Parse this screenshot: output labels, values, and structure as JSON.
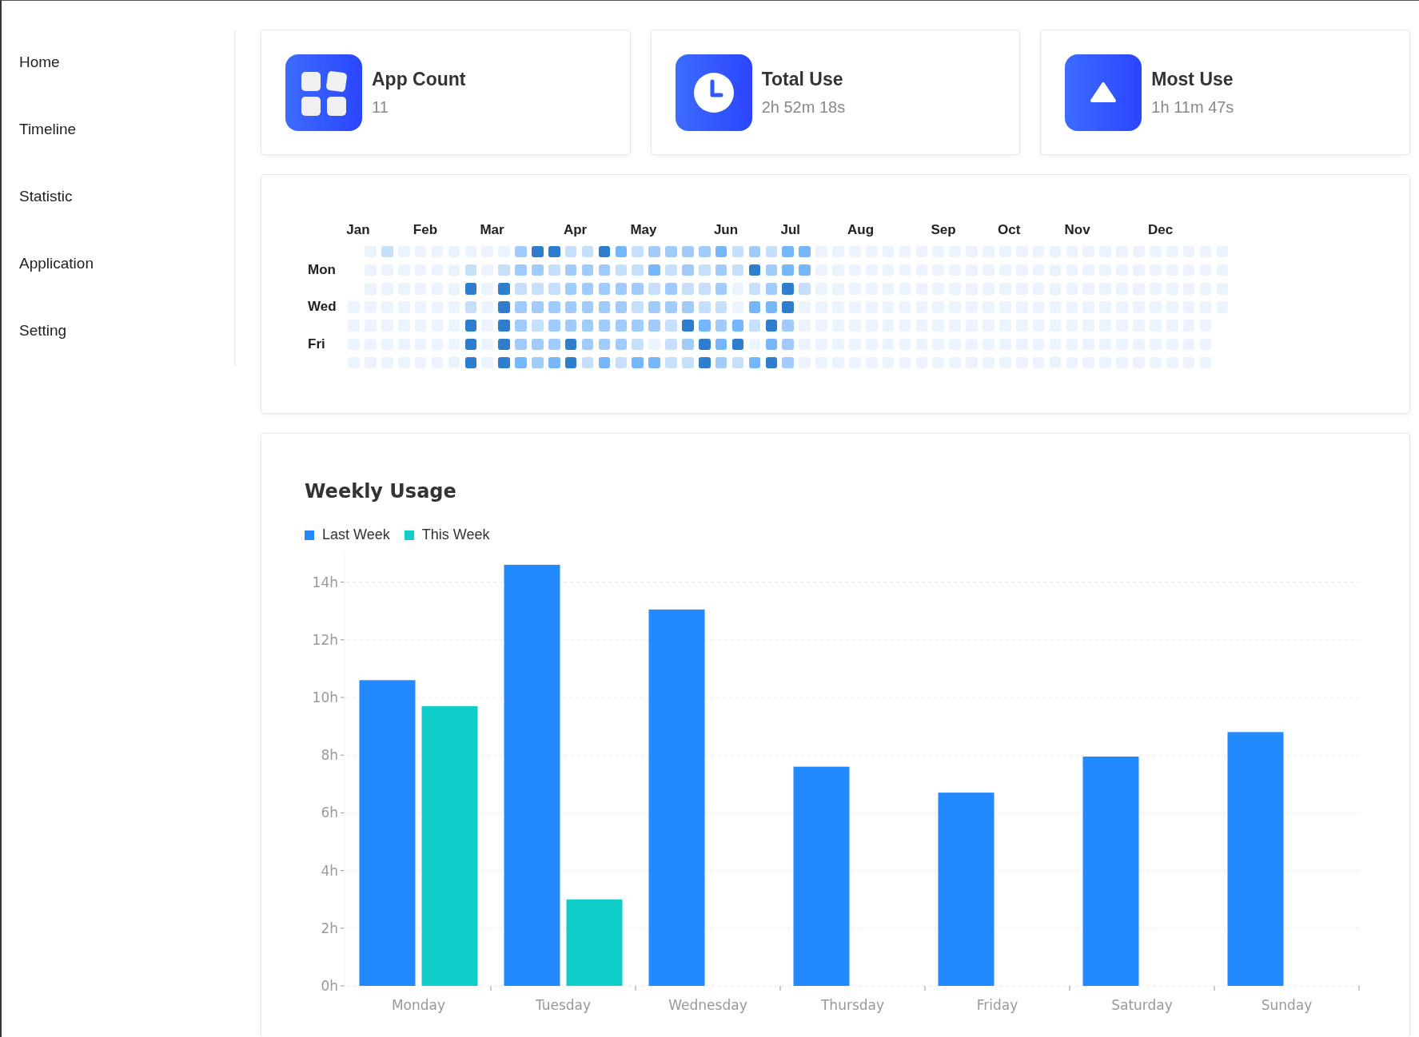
{
  "sidebar": {
    "items": [
      {
        "label": "Home",
        "selected": false
      },
      {
        "label": "Timeline",
        "selected": false
      },
      {
        "label": "Statistic",
        "selected": false
      },
      {
        "label": "Application",
        "selected": false
      },
      {
        "label": "Setting",
        "selected": false
      }
    ]
  },
  "summary_cards": [
    {
      "kind": "apps",
      "title": "App Count",
      "value": "11"
    },
    {
      "kind": "clock",
      "title": "Total Use",
      "value": "2h 52m 18s"
    },
    {
      "kind": "peak",
      "title": "Most Use",
      "value": "1h 11m 47s"
    }
  ],
  "heatmap": {
    "weekday_labels": [
      "Mon",
      "Wed",
      "Fri"
    ],
    "weeks": [
      {
        "month": "Jan",
        "days": [
          {
            "color": "#ebf3fe"
          },
          {
            "color": "#ebf3fe"
          },
          {
            "color": "#ebf3fe"
          },
          {
            "color": "#ebf3fe"
          }
        ]
      },
      {
        "days": [
          {
            "color": "#ebf3fe"
          },
          {
            "color": "#ebf3fe"
          },
          {
            "color": "#ebf3fe"
          },
          {
            "color": "#ebf3fe"
          },
          {
            "color": "#ebf3fe"
          },
          {
            "color": "#ebf3fe"
          },
          {
            "color": "#ebf3fe"
          }
        ]
      },
      {
        "days": [
          {
            "color": "#c6e0fc"
          },
          {
            "color": "#ebf3fe"
          },
          {
            "color": "#ebf3fe"
          },
          {
            "color": "#ebf3fe"
          },
          {
            "color": "#ebf3fe"
          },
          {
            "color": "#ebf3fe"
          },
          {
            "color": "#ebf3fe"
          }
        ]
      },
      {
        "days": [
          {
            "color": "#ebf3fe"
          },
          {
            "color": "#ebf3fe"
          },
          {
            "color": "#ebf3fe"
          },
          {
            "color": "#ebf3fe"
          },
          {
            "color": "#ebf3fe"
          },
          {
            "color": "#ebf3fe"
          },
          {
            "color": "#ebf3fe"
          }
        ]
      },
      {
        "month": "Feb",
        "days": [
          {
            "color": "#ebf3fe"
          },
          {
            "color": "#ebf3fe"
          },
          {
            "color": "#ebf3fe"
          },
          {
            "color": "#ebf3fe"
          },
          {
            "color": "#ebf3fe"
          },
          {
            "color": "#ebf3fe"
          },
          {
            "color": "#ebf3fe"
          }
        ]
      },
      {
        "days": [
          {
            "color": "#ebf3fe"
          },
          {
            "color": "#ebf3fe"
          },
          {
            "color": "#ebf3fe"
          },
          {
            "color": "#ebf3fe"
          },
          {
            "color": "#ebf3fe"
          },
          {
            "color": "#ebf3fe"
          },
          {
            "color": "#ebf3fe"
          }
        ]
      },
      {
        "days": [
          {
            "color": "#ebf3fe"
          },
          {
            "color": "#ebf3fe"
          },
          {
            "color": "#ebf3fe"
          },
          {
            "color": "#ebf3fe"
          },
          {
            "color": "#ebf3fe"
          },
          {
            "color": "#ebf3fe"
          },
          {
            "color": "#ebf3fe"
          }
        ]
      },
      {
        "days": [
          {
            "color": "#ebf3fe"
          },
          {
            "color": "#c6e0fc"
          },
          {
            "color": "#2f7dcd"
          },
          {
            "color": "#c6e0fc"
          },
          {
            "color": "#2f7dcd"
          },
          {
            "color": "#2f7dcd"
          },
          {
            "color": "#2f7dcd"
          }
        ]
      },
      {
        "month": "Mar",
        "days": [
          {
            "color": "#ebf3fe"
          },
          {
            "color": "#ebf3fe"
          },
          {
            "color": "#ebf3fe"
          },
          {
            "color": "#ebf3fe"
          },
          {
            "color": "#ebf3fe"
          },
          {
            "color": "#ebf3fe"
          },
          {
            "color": "#ebf3fe"
          }
        ]
      },
      {
        "days": [
          {
            "color": "#ebf3fe"
          },
          {
            "color": "#c6e0fc"
          },
          {
            "color": "#2f7dcd"
          },
          {
            "color": "#2f7dcd"
          },
          {
            "color": "#2f7dcd"
          },
          {
            "color": "#2f7dcd"
          },
          {
            "color": "#2f7dcd"
          }
        ]
      },
      {
        "days": [
          {
            "color": "#a0cbfb"
          },
          {
            "color": "#a0cbfb"
          },
          {
            "color": "#c6e0fc"
          },
          {
            "color": "#a0cbfb"
          },
          {
            "color": "#a0cbfb"
          },
          {
            "color": "#a0cbfb"
          },
          {
            "color": "#76b6fa"
          }
        ]
      },
      {
        "days": [
          {
            "color": "#2f7dcd"
          },
          {
            "color": "#a0cbfb"
          },
          {
            "color": "#c6e0fc"
          },
          {
            "color": "#a0cbfb"
          },
          {
            "color": "#c6e0fc"
          },
          {
            "color": "#a0cbfb"
          },
          {
            "color": "#a0cbfb"
          }
        ]
      },
      {
        "days": [
          {
            "color": "#2f7dcd"
          },
          {
            "color": "#c6e0fc"
          },
          {
            "color": "#c6e0fc"
          },
          {
            "color": "#a0cbfb"
          },
          {
            "color": "#a0cbfb"
          },
          {
            "color": "#a0cbfb"
          },
          {
            "color": "#76b6fa"
          }
        ]
      },
      {
        "month": "Apr",
        "days": [
          {
            "color": "#c6e0fc"
          },
          {
            "color": "#a0cbfb"
          },
          {
            "color": "#a0cbfb"
          },
          {
            "color": "#a0cbfb"
          },
          {
            "color": "#a0cbfb"
          },
          {
            "color": "#2f7dcd"
          },
          {
            "color": "#2f7dcd"
          }
        ]
      },
      {
        "days": [
          {
            "color": "#c6e0fc"
          },
          {
            "color": "#a0cbfb"
          },
          {
            "color": "#a0cbfb"
          },
          {
            "color": "#a0cbfb"
          },
          {
            "color": "#a0cbfb"
          },
          {
            "color": "#a0cbfb"
          },
          {
            "color": "#c6e0fc"
          }
        ]
      },
      {
        "days": [
          {
            "color": "#2f7dcd"
          },
          {
            "color": "#a0cbfb"
          },
          {
            "color": "#a0cbfb"
          },
          {
            "color": "#a0cbfb"
          },
          {
            "color": "#a0cbfb"
          },
          {
            "color": "#a0cbfb"
          },
          {
            "color": "#76b6fa"
          }
        ]
      },
      {
        "days": [
          {
            "color": "#76b6fa"
          },
          {
            "color": "#c6e0fc"
          },
          {
            "color": "#a0cbfb"
          },
          {
            "color": "#a0cbfb"
          },
          {
            "color": "#a0cbfb"
          },
          {
            "color": "#a0cbfb"
          },
          {
            "color": "#c6e0fc"
          }
        ]
      },
      {
        "month": "May",
        "days": [
          {
            "color": "#c6e0fc"
          },
          {
            "color": "#c6e0fc"
          },
          {
            "color": "#a0cbfb"
          },
          {
            "color": "#c6e0fc"
          },
          {
            "color": "#a0cbfb"
          },
          {
            "color": "#c6e0fc"
          },
          {
            "color": "#76b6fa"
          }
        ]
      },
      {
        "days": [
          {
            "color": "#a0cbfb"
          },
          {
            "color": "#76b6fa"
          },
          {
            "color": "#c6e0fc"
          },
          {
            "color": "#a0cbfb"
          },
          {
            "color": "#a0cbfb"
          },
          {
            "color": "#ebf3fe"
          },
          {
            "color": "#76b6fa"
          }
        ]
      },
      {
        "days": [
          {
            "color": "#a0cbfb"
          },
          {
            "color": "#c6e0fc"
          },
          {
            "color": "#a0cbfb"
          },
          {
            "color": "#a0cbfb"
          },
          {
            "color": "#c6e0fc"
          },
          {
            "color": "#c6e0fc"
          },
          {
            "color": "#c6e0fc"
          }
        ]
      },
      {
        "days": [
          {
            "color": "#a0cbfb"
          },
          {
            "color": "#a0cbfb"
          },
          {
            "color": "#c6e0fc"
          },
          {
            "color": "#a0cbfb"
          },
          {
            "color": "#2f7dcd"
          },
          {
            "color": "#a0cbfb"
          },
          {
            "color": "#c6e0fc"
          }
        ]
      },
      {
        "days": [
          {
            "color": "#a0cbfb"
          },
          {
            "color": "#c6e0fc"
          },
          {
            "color": "#c6e0fc"
          },
          {
            "color": "#c6e0fc"
          },
          {
            "color": "#76b6fa"
          },
          {
            "color": "#2f7dcd"
          },
          {
            "color": "#2f7dcd"
          }
        ]
      },
      {
        "month": "Jun",
        "days": [
          {
            "color": "#76b6fa"
          },
          {
            "color": "#a0cbfb"
          },
          {
            "color": "#a0cbfb"
          },
          {
            "color": "#c6e0fc"
          },
          {
            "color": "#a0cbfb"
          },
          {
            "color": "#76b6fa"
          },
          {
            "color": "#a0cbfb"
          }
        ]
      },
      {
        "days": [
          {
            "color": "#c6e0fc"
          },
          {
            "color": "#c6e0fc"
          },
          {
            "color": "#ebf3fe"
          },
          {
            "color": "#ebf3fe"
          },
          {
            "color": "#76b6fa"
          },
          {
            "color": "#2f7dcd"
          },
          {
            "color": "#c6e0fc"
          }
        ]
      },
      {
        "days": [
          {
            "color": "#a0cbfb"
          },
          {
            "color": "#2f7dcd"
          },
          {
            "color": "#c6e0fc"
          },
          {
            "color": "#76b6fa"
          },
          {
            "color": "#c6e0fc"
          },
          {
            "color": "#ebf3fe"
          },
          {
            "color": "#76b6fa"
          }
        ]
      },
      {
        "days": [
          {
            "color": "#c6e0fc"
          },
          {
            "color": "#a0cbfb"
          },
          {
            "color": "#a0cbfb"
          },
          {
            "color": "#76b6fa"
          },
          {
            "color": "#2f7dcd"
          },
          {
            "color": "#76b6fa"
          },
          {
            "color": "#2f7dcd"
          }
        ]
      },
      {
        "month": "Jul",
        "days": [
          {
            "color": "#76b6fa"
          },
          {
            "color": "#76b6fa"
          },
          {
            "color": "#2f7dcd"
          },
          {
            "color": "#2f7dcd"
          },
          {
            "color": "#a0cbfb"
          },
          {
            "color": "#a0cbfb"
          },
          {
            "color": "#a0cbfb"
          }
        ]
      },
      {
        "days": [
          {
            "color": "#76b6fa"
          },
          {
            "color": "#76b6fa"
          },
          {
            "color": "#c6e0fc"
          },
          {
            "color": "#ebf3fe"
          },
          {
            "color": "#ebf3fe"
          },
          {
            "color": "#ebf3fe"
          },
          {
            "color": "#ebf3fe"
          }
        ]
      },
      {
        "days": [
          {
            "color": "#ebf3fe"
          },
          {
            "color": "#ebf3fe"
          },
          {
            "color": "#ebf3fe"
          },
          {
            "color": "#ebf3fe"
          },
          {
            "color": "#ebf3fe"
          },
          {
            "color": "#ebf3fe"
          },
          {
            "color": "#ebf3fe"
          }
        ]
      },
      {
        "days": [
          {
            "color": "#ebf3fe"
          },
          {
            "color": "#ebf3fe"
          },
          {
            "color": "#ebf3fe"
          },
          {
            "color": "#ebf3fe"
          },
          {
            "color": "#ebf3fe"
          },
          {
            "color": "#ebf3fe"
          },
          {
            "color": "#ebf3fe"
          }
        ]
      },
      {
        "month": "Aug",
        "days": [
          {
            "color": "#ebf3fe"
          },
          {
            "color": "#ebf3fe"
          },
          {
            "color": "#ebf3fe"
          },
          {
            "color": "#ebf3fe"
          },
          {
            "color": "#ebf3fe"
          },
          {
            "color": "#ebf3fe"
          },
          {
            "color": "#ebf3fe"
          }
        ]
      },
      {
        "days": [
          {
            "color": "#ebf3fe"
          },
          {
            "color": "#ebf3fe"
          },
          {
            "color": "#ebf3fe"
          },
          {
            "color": "#ebf3fe"
          },
          {
            "color": "#ebf3fe"
          },
          {
            "color": "#ebf3fe"
          },
          {
            "color": "#ebf3fe"
          }
        ]
      },
      {
        "days": [
          {
            "color": "#ebf3fe"
          },
          {
            "color": "#ebf3fe"
          },
          {
            "color": "#ebf3fe"
          },
          {
            "color": "#ebf3fe"
          },
          {
            "color": "#ebf3fe"
          },
          {
            "color": "#ebf3fe"
          },
          {
            "color": "#ebf3fe"
          }
        ]
      },
      {
        "days": [
          {
            "color": "#ebf3fe"
          },
          {
            "color": "#ebf3fe"
          },
          {
            "color": "#ebf3fe"
          },
          {
            "color": "#ebf3fe"
          },
          {
            "color": "#ebf3fe"
          },
          {
            "color": "#ebf3fe"
          },
          {
            "color": "#ebf3fe"
          }
        ]
      },
      {
        "days": [
          {
            "color": "#ebf3fe"
          },
          {
            "color": "#ebf3fe"
          },
          {
            "color": "#ebf3fe"
          },
          {
            "color": "#ebf3fe"
          },
          {
            "color": "#ebf3fe"
          },
          {
            "color": "#ebf3fe"
          },
          {
            "color": "#ebf3fe"
          }
        ]
      },
      {
        "month": "Sep",
        "days": [
          {
            "color": "#ebf3fe"
          },
          {
            "color": "#ebf3fe"
          },
          {
            "color": "#ebf3fe"
          },
          {
            "color": "#ebf3fe"
          },
          {
            "color": "#ebf3fe"
          },
          {
            "color": "#ebf3fe"
          },
          {
            "color": "#ebf3fe"
          }
        ]
      },
      {
        "days": [
          {
            "color": "#ebf3fe"
          },
          {
            "color": "#ebf3fe"
          },
          {
            "color": "#ebf3fe"
          },
          {
            "color": "#ebf3fe"
          },
          {
            "color": "#ebf3fe"
          },
          {
            "color": "#ebf3fe"
          },
          {
            "color": "#ebf3fe"
          }
        ]
      },
      {
        "days": [
          {
            "color": "#ebf3fe"
          },
          {
            "color": "#ebf3fe"
          },
          {
            "color": "#ebf3fe"
          },
          {
            "color": "#ebf3fe"
          },
          {
            "color": "#ebf3fe"
          },
          {
            "color": "#ebf3fe"
          },
          {
            "color": "#ebf3fe"
          }
        ]
      },
      {
        "days": [
          {
            "color": "#ebf3fe"
          },
          {
            "color": "#ebf3fe"
          },
          {
            "color": "#ebf3fe"
          },
          {
            "color": "#ebf3fe"
          },
          {
            "color": "#ebf3fe"
          },
          {
            "color": "#ebf3fe"
          },
          {
            "color": "#ebf3fe"
          }
        ]
      },
      {
        "month": "Oct",
        "days": [
          {
            "color": "#ebf3fe"
          },
          {
            "color": "#ebf3fe"
          },
          {
            "color": "#ebf3fe"
          },
          {
            "color": "#ebf3fe"
          },
          {
            "color": "#ebf3fe"
          },
          {
            "color": "#ebf3fe"
          },
          {
            "color": "#ebf3fe"
          }
        ]
      },
      {
        "days": [
          {
            "color": "#ebf3fe"
          },
          {
            "color": "#ebf3fe"
          },
          {
            "color": "#ebf3fe"
          },
          {
            "color": "#ebf3fe"
          },
          {
            "color": "#ebf3fe"
          },
          {
            "color": "#ebf3fe"
          },
          {
            "color": "#ebf3fe"
          }
        ]
      },
      {
        "days": [
          {
            "color": "#ebf3fe"
          },
          {
            "color": "#ebf3fe"
          },
          {
            "color": "#ebf3fe"
          },
          {
            "color": "#ebf3fe"
          },
          {
            "color": "#ebf3fe"
          },
          {
            "color": "#ebf3fe"
          },
          {
            "color": "#ebf3fe"
          }
        ]
      },
      {
        "days": [
          {
            "color": "#ebf3fe"
          },
          {
            "color": "#ebf3fe"
          },
          {
            "color": "#ebf3fe"
          },
          {
            "color": "#ebf3fe"
          },
          {
            "color": "#ebf3fe"
          },
          {
            "color": "#ebf3fe"
          },
          {
            "color": "#ebf3fe"
          }
        ]
      },
      {
        "month": "Nov",
        "days": [
          {
            "color": "#ebf3fe"
          },
          {
            "color": "#ebf3fe"
          },
          {
            "color": "#ebf3fe"
          },
          {
            "color": "#ebf3fe"
          },
          {
            "color": "#ebf3fe"
          },
          {
            "color": "#ebf3fe"
          },
          {
            "color": "#ebf3fe"
          }
        ]
      },
      {
        "days": [
          {
            "color": "#ebf3fe"
          },
          {
            "color": "#ebf3fe"
          },
          {
            "color": "#ebf3fe"
          },
          {
            "color": "#ebf3fe"
          },
          {
            "color": "#ebf3fe"
          },
          {
            "color": "#ebf3fe"
          },
          {
            "color": "#ebf3fe"
          }
        ]
      },
      {
        "days": [
          {
            "color": "#ebf3fe"
          },
          {
            "color": "#ebf3fe"
          },
          {
            "color": "#ebf3fe"
          },
          {
            "color": "#ebf3fe"
          },
          {
            "color": "#ebf3fe"
          },
          {
            "color": "#ebf3fe"
          },
          {
            "color": "#ebf3fe"
          }
        ]
      },
      {
        "days": [
          {
            "color": "#ebf3fe"
          },
          {
            "color": "#ebf3fe"
          },
          {
            "color": "#ebf3fe"
          },
          {
            "color": "#ebf3fe"
          },
          {
            "color": "#ebf3fe"
          },
          {
            "color": "#ebf3fe"
          },
          {
            "color": "#ebf3fe"
          }
        ]
      },
      {
        "days": [
          {
            "color": "#ebf3fe"
          },
          {
            "color": "#ebf3fe"
          },
          {
            "color": "#ebf3fe"
          },
          {
            "color": "#ebf3fe"
          },
          {
            "color": "#ebf3fe"
          },
          {
            "color": "#ebf3fe"
          },
          {
            "color": "#ebf3fe"
          }
        ]
      },
      {
        "month": "Dec",
        "days": [
          {
            "color": "#ebf3fe"
          },
          {
            "color": "#ebf3fe"
          },
          {
            "color": "#ebf3fe"
          },
          {
            "color": "#ebf3fe"
          },
          {
            "color": "#ebf3fe"
          },
          {
            "color": "#ebf3fe"
          },
          {
            "color": "#ebf3fe"
          }
        ]
      },
      {
        "days": [
          {
            "color": "#ebf3fe"
          },
          {
            "color": "#ebf3fe"
          },
          {
            "color": "#ebf3fe"
          },
          {
            "color": "#ebf3fe"
          },
          {
            "color": "#ebf3fe"
          },
          {
            "color": "#ebf3fe"
          },
          {
            "color": "#ebf3fe"
          }
        ]
      },
      {
        "days": [
          {
            "color": "#ebf3fe"
          },
          {
            "color": "#ebf3fe"
          },
          {
            "color": "#ebf3fe"
          },
          {
            "color": "#ebf3fe"
          },
          {
            "color": "#ebf3fe"
          },
          {
            "color": "#ebf3fe"
          },
          {
            "color": "#ebf3fe"
          }
        ]
      },
      {
        "days": [
          {
            "color": "#ebf3fe"
          },
          {
            "color": "#ebf3fe"
          },
          {
            "color": "#ebf3fe"
          },
          {
            "color": "#ebf3fe"
          },
          {
            "color": "#ebf3fe"
          },
          {
            "color": "#ebf3fe"
          },
          {
            "color": "#ebf3fe"
          }
        ]
      },
      {
        "days": [
          {
            "color": "#ebf3fe"
          },
          {
            "color": "#ebf3fe"
          },
          {
            "color": "#ebf3fe"
          },
          {
            "color": "#ebf3fe"
          }
        ]
      }
    ]
  },
  "weekly_usage": {
    "chart_data": {
      "type": "bar",
      "title": "Weekly Usage",
      "categories": [
        "Monday",
        "Tuesday",
        "Wednesday",
        "Thursday",
        "Friday",
        "Saturday",
        "Sunday"
      ],
      "series": [
        {
          "name": "Last Week",
          "color": "#2389ff",
          "values": [
            10.6,
            14.6,
            13.05,
            7.6,
            6.7,
            7.95,
            8.8
          ]
        },
        {
          "name": "This Week",
          "color": "#0fcdc9",
          "values": [
            9.7,
            3.0,
            null,
            null,
            null,
            null,
            null
          ]
        }
      ],
      "grid": true,
      "legend": "top-left",
      "ylim": [
        0,
        15
      ],
      "yticks": [
        {
          "value": 0,
          "label": "0h"
        },
        {
          "value": 2,
          "label": "2h"
        },
        {
          "value": 4,
          "label": "4h"
        },
        {
          "value": 6,
          "label": "6h"
        },
        {
          "value": 8,
          "label": "8h"
        },
        {
          "value": 10,
          "label": "10h"
        },
        {
          "value": 12,
          "label": "12h"
        },
        {
          "value": 14,
          "label": "14h"
        }
      ]
    }
  }
}
